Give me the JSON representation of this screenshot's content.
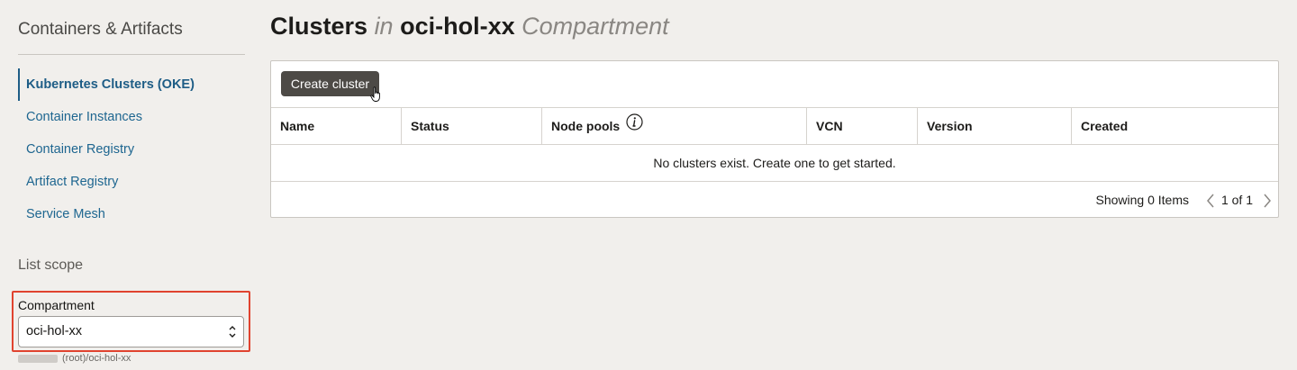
{
  "sidebar": {
    "title": "Containers & Artifacts",
    "items": [
      {
        "label": "Kubernetes Clusters (OKE)",
        "active": true
      },
      {
        "label": "Container Instances"
      },
      {
        "label": "Container Registry"
      },
      {
        "label": "Artifact Registry"
      },
      {
        "label": "Service Mesh"
      }
    ],
    "scope_title": "List scope",
    "compartment": {
      "label": "Compartment",
      "value": "oci-hol-xx",
      "path": "(root)/oci-hol-xx"
    }
  },
  "main": {
    "title": {
      "part1": "Clusters",
      "part2": "in",
      "part3": "oci-hol-xx",
      "part4": "Compartment"
    },
    "create_button": "Create cluster",
    "columns": [
      "Name",
      "Status",
      "Node pools",
      "VCN",
      "Version",
      "Created"
    ],
    "empty_message": "No clusters exist. Create one to get started.",
    "showing": "Showing 0 Items",
    "page_info": "1 of 1"
  },
  "colors": {
    "background": "#f1efec",
    "link": "#1e6690",
    "button": "#4d4a46",
    "highlight_border": "#e0432f"
  },
  "icons": [
    "info-icon",
    "hand-cursor-icon",
    "chevron-left-icon",
    "chevron-right-icon",
    "select-chevrons-icon"
  ]
}
